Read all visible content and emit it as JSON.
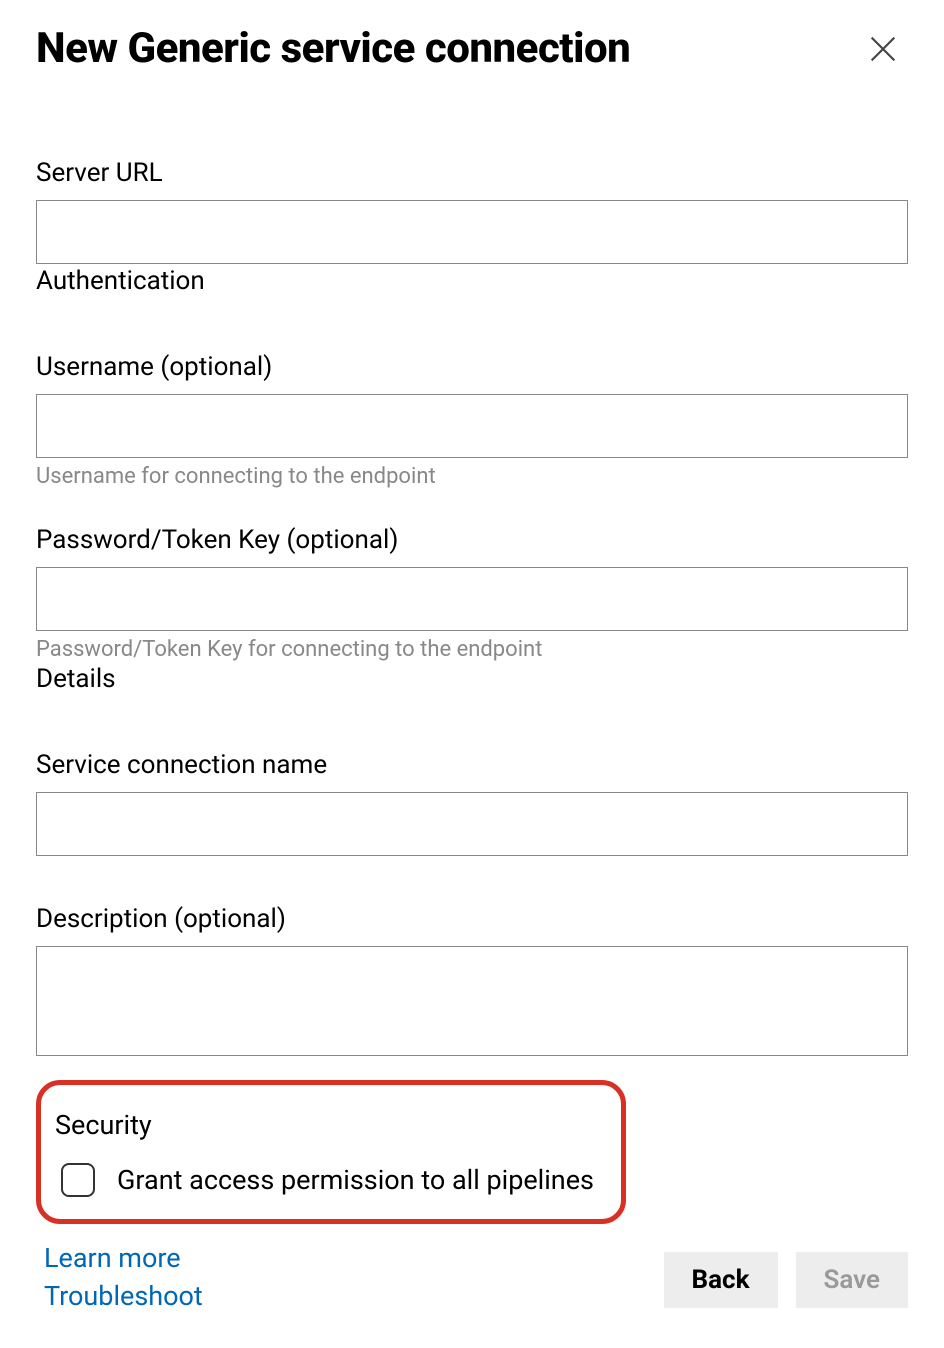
{
  "header": {
    "title": "New Generic service connection"
  },
  "fields": {
    "server_url": {
      "label": "Server URL",
      "value": ""
    },
    "authentication_section": "Authentication",
    "username": {
      "label": "Username (optional)",
      "value": "",
      "helper": "Username for connecting to the endpoint"
    },
    "password": {
      "label": "Password/Token Key (optional)",
      "value": "",
      "helper": "Password/Token Key for connecting to the endpoint"
    },
    "details_section": "Details",
    "service_name": {
      "label": "Service connection name",
      "value": ""
    },
    "description": {
      "label": "Description (optional)",
      "value": ""
    }
  },
  "security": {
    "heading": "Security",
    "checkbox_label": "Grant access permission to all pipelines",
    "checked": false
  },
  "footer": {
    "learn_more": "Learn more",
    "troubleshoot": "Troubleshoot",
    "back": "Back",
    "save": "Save"
  }
}
